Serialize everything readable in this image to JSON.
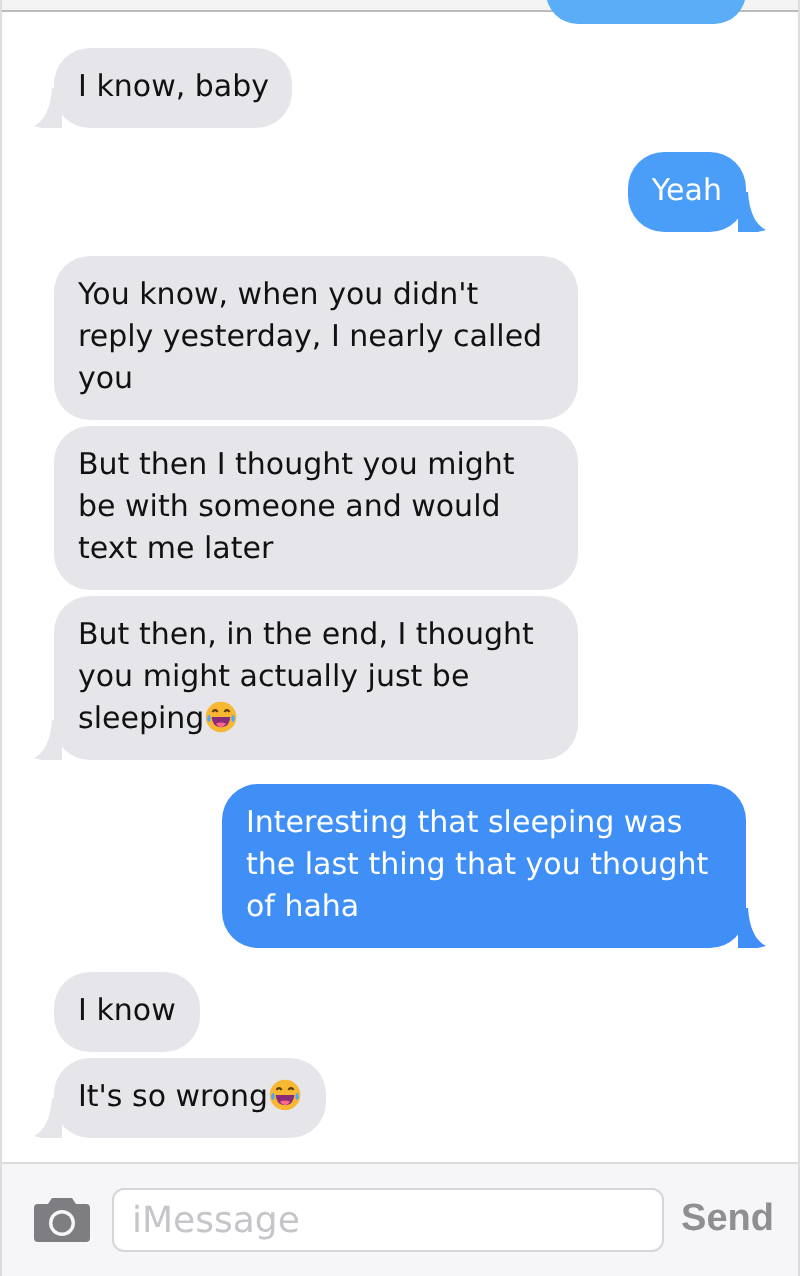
{
  "messages": [
    {
      "kind": "received",
      "text": "I know, baby",
      "tail": true,
      "laugh_emoji": false
    },
    {
      "kind": "sent",
      "text": "Yeah",
      "tail": true,
      "laugh_emoji": false
    },
    {
      "kind": "received",
      "text": "You know, when you didn't reply yesterday, I nearly called you",
      "tail": false,
      "laugh_emoji": false
    },
    {
      "kind": "received",
      "text": "But then I thought you might be with someone and would text me later",
      "tail": false,
      "laugh_emoji": false
    },
    {
      "kind": "received",
      "text": "But then, in the end, I thought you might actually just be sleeping",
      "tail": true,
      "laugh_emoji": true
    },
    {
      "kind": "sent",
      "text": "Interesting that sleeping was the last thing that you thought of haha",
      "tail": true,
      "laugh_emoji": false
    },
    {
      "kind": "received",
      "text": "I know",
      "tail": false,
      "laugh_emoji": false
    },
    {
      "kind": "received",
      "text": "It's so wrong",
      "tail": true,
      "laugh_emoji": true
    }
  ],
  "composer": {
    "placeholder": "iMessage",
    "send_label": "Send"
  }
}
